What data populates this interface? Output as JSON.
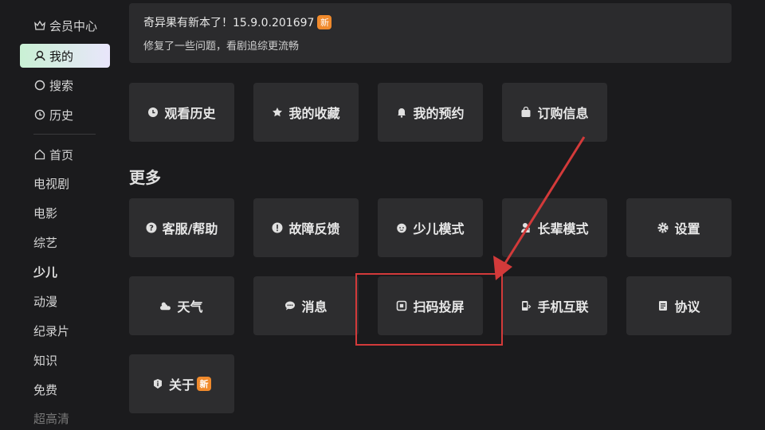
{
  "sidebar": {
    "items": [
      {
        "label": "会员中心",
        "icon": "crown-icon"
      },
      {
        "label": "我的",
        "icon": "user-icon"
      },
      {
        "label": "搜索",
        "icon": "search-icon"
      },
      {
        "label": "历史",
        "icon": "clock-icon"
      },
      {
        "label": "首页",
        "icon": "home-icon"
      },
      {
        "label": "电视剧"
      },
      {
        "label": "电影"
      },
      {
        "label": "综艺"
      },
      {
        "label": "少儿"
      },
      {
        "label": "动漫"
      },
      {
        "label": "纪录片"
      },
      {
        "label": "知识"
      },
      {
        "label": "免费"
      },
      {
        "label": "超高清"
      }
    ],
    "active_index": 1
  },
  "notice": {
    "title": "奇异果有新本了！15.9.0.201697",
    "badge": "新",
    "subtitle": "修复了一些问题，看剧追综更流畅"
  },
  "quick": [
    {
      "label": "观看历史",
      "icon": "clock-icon"
    },
    {
      "label": "我的收藏",
      "icon": "star-icon"
    },
    {
      "label": "我的预约",
      "icon": "bell-icon"
    },
    {
      "label": "订购信息",
      "icon": "bag-icon"
    }
  ],
  "more_title": "更多",
  "more": [
    {
      "label": "客服/帮助",
      "icon": "help-icon"
    },
    {
      "label": "故障反馈",
      "icon": "alert-icon"
    },
    {
      "label": "少儿模式",
      "icon": "child-icon"
    },
    {
      "label": "长辈模式",
      "icon": "elder-icon"
    },
    {
      "label": "设置",
      "icon": "gear-icon"
    },
    {
      "label": "天气",
      "icon": "weather-icon"
    },
    {
      "label": "消息",
      "icon": "message-icon"
    },
    {
      "label": "扫码投屏",
      "icon": "scan-icon"
    },
    {
      "label": "手机互联",
      "icon": "phone-icon"
    },
    {
      "label": "协议",
      "icon": "document-icon"
    },
    {
      "label": "关于",
      "icon": "info-icon",
      "badge": "新"
    }
  ],
  "colors": {
    "accent_red": "#d33a3a",
    "badge_orange": "#f08a2c",
    "active_gradient_start": "#c9f0d4",
    "active_gradient_end": "#e9e6fb"
  }
}
